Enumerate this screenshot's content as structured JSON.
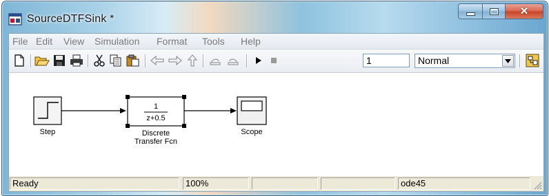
{
  "window": {
    "title": "SourceDTFSink *"
  },
  "menu": {
    "items": [
      "File",
      "Edit",
      "View",
      "Simulation",
      "Format",
      "Tools",
      "Help"
    ]
  },
  "toolbar": {
    "buttons": [
      "new-icon",
      "open-icon",
      "save-icon",
      "print-icon",
      "cut-icon",
      "copy-icon",
      "paste-icon",
      "back-icon",
      "forward-icon",
      "up-icon",
      "undo-icon",
      "redo-icon",
      "play-icon",
      "stop-icon"
    ],
    "stop_time": "1",
    "sim_mode": "Normal",
    "library_button_icon": "library-browser-icon"
  },
  "blocks": {
    "step": {
      "label": "Step"
    },
    "tf": {
      "numerator": "1",
      "denominator": "z+0.5",
      "label_line1": "Discrete",
      "label_line2": "Transfer Fcn"
    },
    "scope": {
      "label": "Scope"
    }
  },
  "status": {
    "ready": "Ready",
    "zoom": "100%",
    "solver": "ode45"
  },
  "colors": {
    "chrome_accent": "#6aa6cf",
    "close_button": "#c84324",
    "canvas": "#ffffff"
  }
}
